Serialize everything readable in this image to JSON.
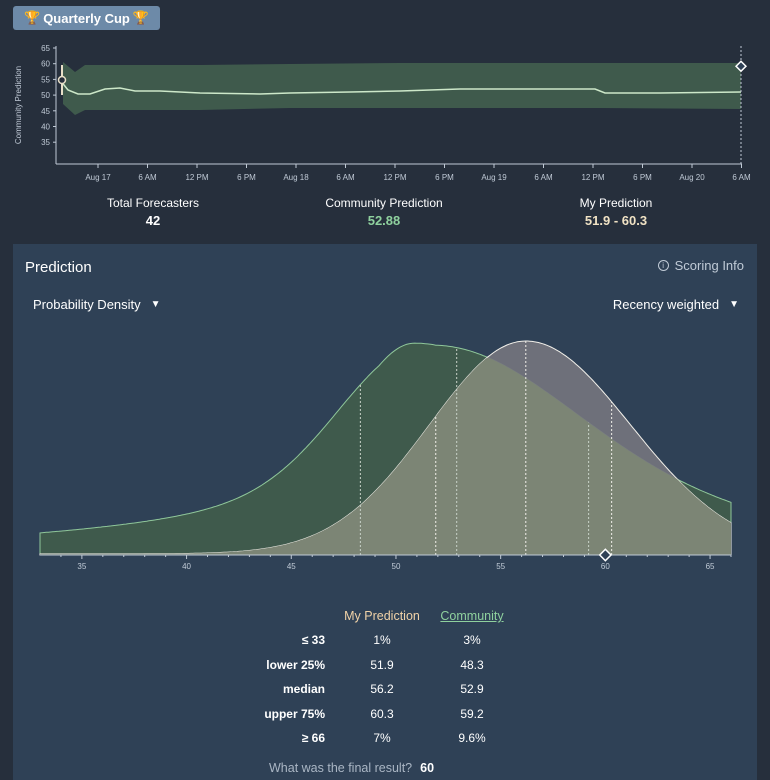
{
  "header": {
    "badge_label": "Quarterly Cup",
    "badge_icon": "trophy-icon"
  },
  "top_chart": {
    "ylabel": "Community Prediction",
    "yticks": [
      "65",
      "60",
      "55",
      "50",
      "45",
      "40",
      "35"
    ],
    "xticks": [
      "Aug 17",
      "6 AM",
      "12 PM",
      "6 PM",
      "Aug 18",
      "6 AM",
      "12 PM",
      "6 PM",
      "Aug 19",
      "6 AM",
      "12 PM",
      "6 PM",
      "Aug 20",
      "6 AM"
    ],
    "colors": {
      "band": "#3f5a4c",
      "line": "#cde8c9",
      "marker": "#e8dfc8"
    }
  },
  "stats": {
    "total_forecasters_label": "Total Forecasters",
    "total_forecasters_value": "42",
    "community_label": "Community Prediction",
    "community_value": "52.88",
    "my_label": "My Prediction",
    "my_value": "51.9 - 60.3"
  },
  "panel": {
    "title": "Prediction",
    "scoring_label": "Scoring Info",
    "view_select": "Probability Density",
    "weight_select": "Recency weighted"
  },
  "chart_data": {
    "type": "area",
    "x": [
      33,
      66
    ],
    "xticks": [
      "35",
      "40",
      "45",
      "50",
      "55",
      "60",
      "65"
    ],
    "series": [
      {
        "name": "Community",
        "color": "#3f5a4c",
        "mode": 50.9,
        "quartiles": [
          48.3,
          52.9,
          59.2
        ]
      },
      {
        "name": "My Prediction",
        "color": "#76767e",
        "mode": 56.2,
        "quartiles": [
          51.9,
          56.2,
          60.3
        ]
      }
    ],
    "marker_value": 60
  },
  "table": {
    "col_my": "My Prediction",
    "col_community": "Community",
    "rows": [
      {
        "label": "≤ 33",
        "my": "1%",
        "community": "3%"
      },
      {
        "label": "lower 25%",
        "my": "51.9",
        "community": "48.3"
      },
      {
        "label": "median",
        "my": "56.2",
        "community": "52.9"
      },
      {
        "label": "upper 75%",
        "my": "60.3",
        "community": "59.2"
      },
      {
        "label": "≥ 66",
        "my": "7%",
        "community": "9.6%"
      }
    ]
  },
  "final": {
    "question": "What was the final result?",
    "value": "60"
  }
}
